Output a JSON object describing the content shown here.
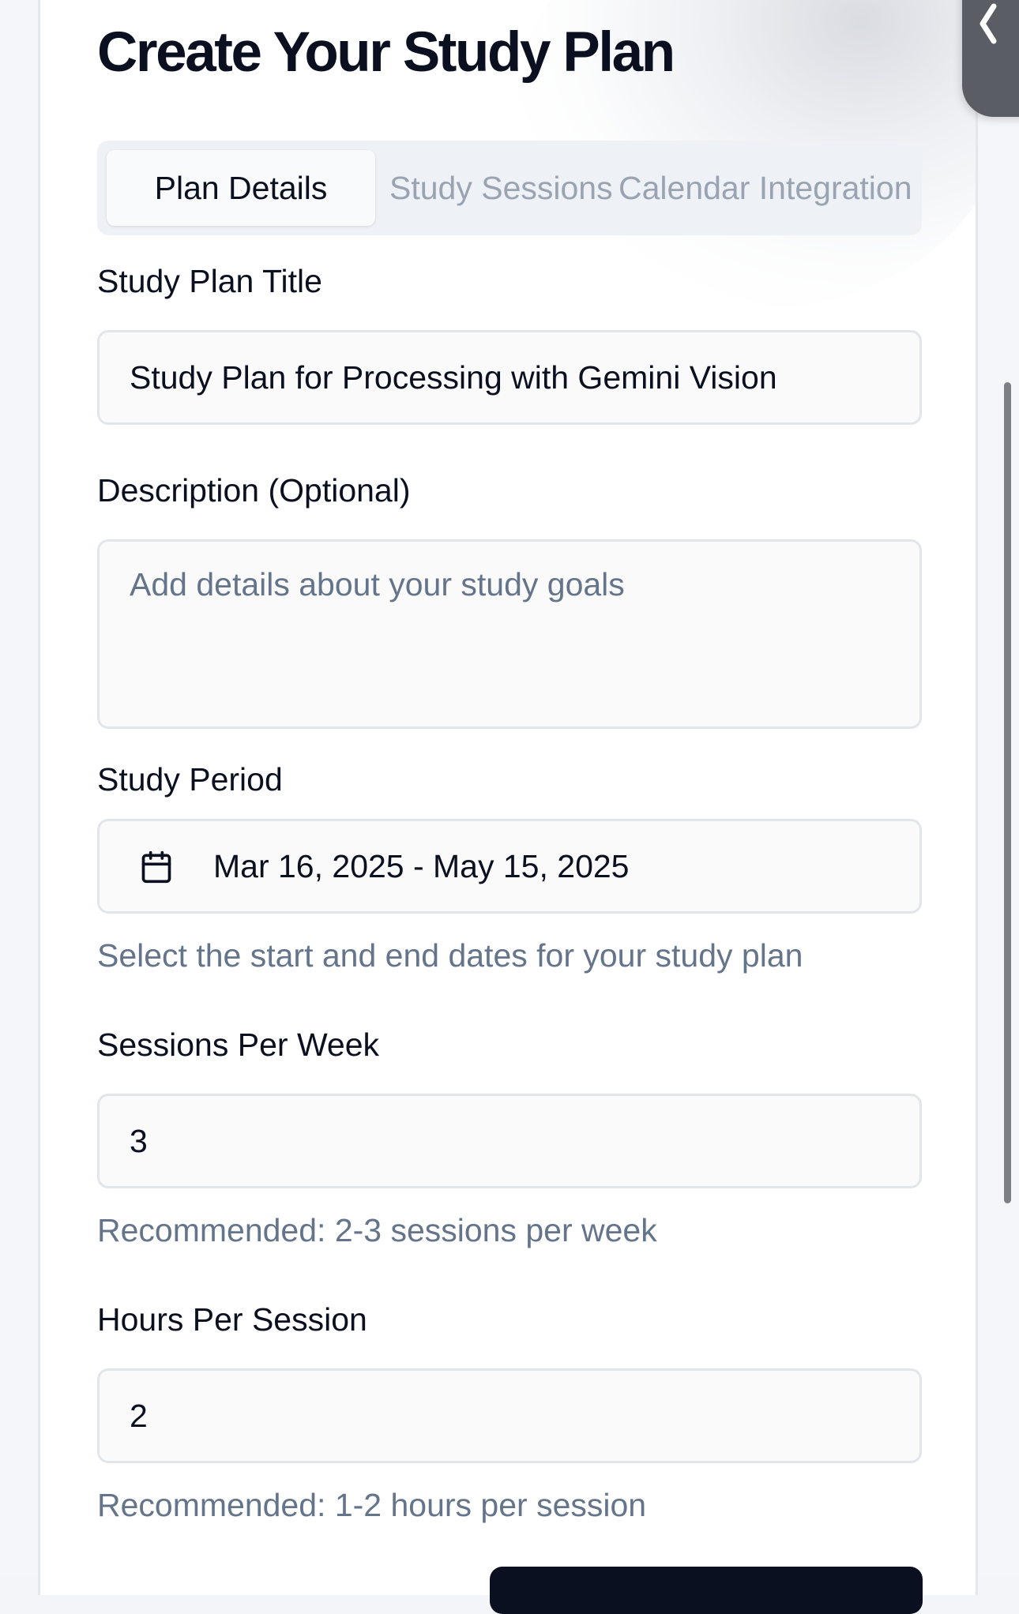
{
  "page": {
    "title": "Create Your Study Plan"
  },
  "tabs": [
    {
      "label": "Plan Details",
      "active": true
    },
    {
      "label": "Study Sessions",
      "active": false
    },
    {
      "label": "Calendar Integration",
      "active": false
    }
  ],
  "form": {
    "title_label": "Study Plan Title",
    "title_value": "Study Plan for Processing with Gemini Vision",
    "description_label": "Description (Optional)",
    "description_placeholder": "Add details about your study goals",
    "period_label": "Study Period",
    "period_value": "Mar 16, 2025 - May 15, 2025",
    "period_hint": "Select the start and end dates for your study plan",
    "sessions_label": "Sessions Per Week",
    "sessions_value": "3",
    "sessions_hint": "Recommended: 2-3 sessions per week",
    "hours_label": "Hours Per Session",
    "hours_value": "2",
    "hours_hint": "Recommended: 1-2 hours per session"
  },
  "icons": {
    "calendar": "calendar-icon",
    "collapse": "chevron-left-icon"
  },
  "colors": {
    "text": "#0b1020",
    "muted": "#64748b",
    "inactive_tab": "#9aa3b2",
    "field_bg": "#fafafa",
    "field_border": "#e2e5ea",
    "tabs_bg": "#eef1f6"
  }
}
